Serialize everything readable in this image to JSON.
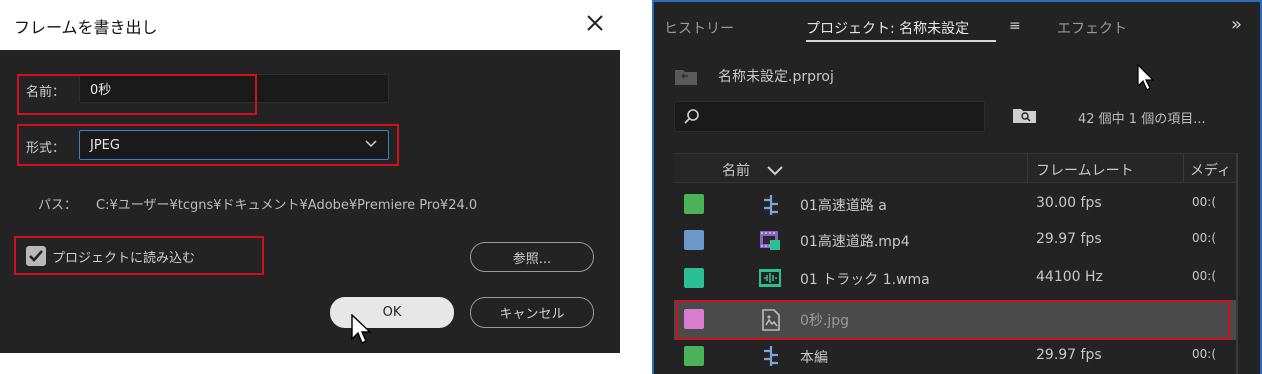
{
  "dialog": {
    "title": "フレームを書き出し",
    "name_label": "名前：",
    "name_value": "0秒",
    "format_label": "形式：",
    "format_value": "JPEG",
    "path_label": "パス：",
    "path_value": "C:¥ユーザー¥tcgns¥ドキュメント¥Adobe¥Premiere Pro¥24.0",
    "import_checkbox_label": "プロジェクトに読み込む",
    "import_checked": true,
    "browse_label": "参照...",
    "ok_label": "OK",
    "cancel_label": "キャンセル"
  },
  "panel": {
    "tabs": [
      "ヒストリー",
      "プロジェクト: 名称未設定",
      "エフェクト"
    ],
    "active_tab": "プロジェクト: 名称未設定",
    "menu_icon": "≡",
    "overflow_icon": "»",
    "project_file": "名称未設定.prproj",
    "search_placeholder": "",
    "item_count": "42 個中 1 個の項目...",
    "columns": {
      "name": "名前",
      "frame_rate": "フレームレート",
      "media": "メディ"
    },
    "rows": [
      {
        "color": "#4cb25a",
        "icon": "sequence-icon",
        "name": "01高速道路 a",
        "fps": "30.00 fps",
        "media": "00:("
      },
      {
        "color": "#6d97c9",
        "icon": "video-clip-icon",
        "name": "01高速道路.mp4",
        "fps": "29.97 fps",
        "media": "00:("
      },
      {
        "color": "#2cbf94",
        "icon": "audio-clip-icon",
        "name": "01 トラック 1.wma",
        "fps": "44100 Hz",
        "media": "00:("
      },
      {
        "color": "#d87cd0",
        "icon": "image-file-icon",
        "name": "0秒.jpg",
        "fps": "",
        "media": ""
      },
      {
        "color": "#4cb25a",
        "icon": "sequence-icon",
        "name": "本編",
        "fps": "29.97 fps",
        "media": "00:("
      }
    ]
  },
  "colors": {
    "highlight_red": "#d0101a",
    "panel_accent_blue": "#2d6dbd",
    "checkbox_gray": "#b8b8b8"
  }
}
